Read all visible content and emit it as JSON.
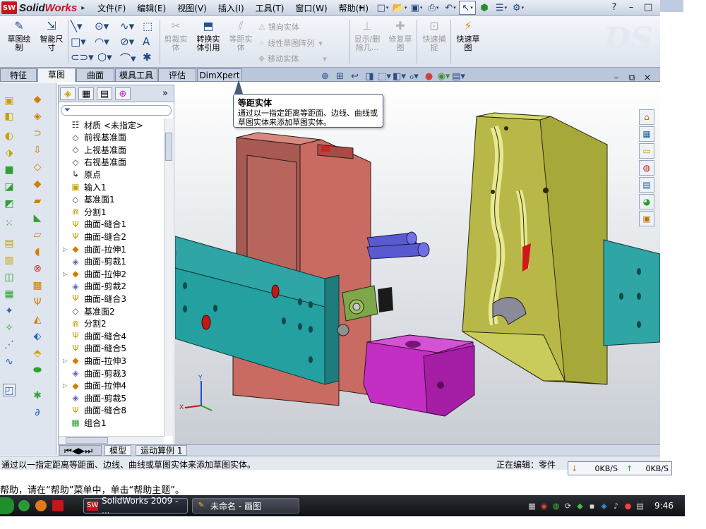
{
  "app": {
    "name": "SolidWorks",
    "name_prefix": "Solid",
    "name_suffix": "Works",
    "logo_mark": "SW"
  },
  "menu": [
    "文件(F)",
    "编辑(E)",
    "视图(V)",
    "插入(I)",
    "工具(T)",
    "窗口(W)",
    "帮助(H)"
  ],
  "quick_access_icons": [
    "new-document-icon",
    "open-icon",
    "save-icon",
    "print-icon",
    "undo-icon",
    "select-arrow-icon",
    "rebuild-icon",
    "file-properties-icon",
    "options-icon"
  ],
  "window_controls": [
    "?",
    "–",
    "□",
    "×"
  ],
  "command_manager": {
    "big_buttons": [
      {
        "label": "草图绘\n制",
        "icon": "sketch-icon",
        "enabled": true
      },
      {
        "label": "智能尺\n寸",
        "icon": "smart-dimension-icon",
        "enabled": true
      },
      {
        "label": "剪裁实\n体",
        "icon": "trim-icon",
        "enabled": false
      },
      {
        "label": "转换实\n体引用",
        "icon": "convert-entities-icon",
        "enabled": true
      },
      {
        "label": "等距实\n体",
        "icon": "offset-entities-icon",
        "enabled": false
      },
      {
        "label": "显示/删\n除几...",
        "icon": "display-relations-icon",
        "enabled": false
      },
      {
        "label": "修复草\n图",
        "icon": "repair-sketch-icon",
        "enabled": false
      },
      {
        "label": "快速捕\n捉",
        "icon": "quick-snaps-icon",
        "enabled": false
      },
      {
        "label": "快速草\n图",
        "icon": "rapid-sketch-icon",
        "enabled": true
      }
    ],
    "list_buttons": [
      "镜向实体",
      "线性草图阵列",
      "移动实体"
    ]
  },
  "tabs": [
    "特征",
    "草图",
    "曲面",
    "模具工具",
    "评估",
    "DimXpert"
  ],
  "active_tab": "草图",
  "feature_tree": {
    "items": [
      {
        "label": "材质 <未指定>",
        "icon": "material-icon",
        "expandable": false
      },
      {
        "label": "前视基准面",
        "icon": "plane-icon",
        "expandable": false
      },
      {
        "label": "上视基准面",
        "icon": "plane-icon",
        "expandable": false
      },
      {
        "label": "右视基准面",
        "icon": "plane-icon",
        "expandable": false
      },
      {
        "label": "原点",
        "icon": "origin-icon",
        "expandable": false
      },
      {
        "label": "输入1",
        "icon": "import-icon",
        "expandable": false
      },
      {
        "label": "基准面1",
        "icon": "plane-icon",
        "expandable": false
      },
      {
        "label": "分割1",
        "icon": "split-icon",
        "expandable": false
      },
      {
        "label": "曲面-缝合1",
        "icon": "knit-surface-icon",
        "expandable": false
      },
      {
        "label": "曲面-缝合2",
        "icon": "knit-surface-icon",
        "expandable": false
      },
      {
        "label": "曲面-拉伸1",
        "icon": "extrude-surface-icon",
        "expandable": true
      },
      {
        "label": "曲面-剪裁1",
        "icon": "trim-surface-icon",
        "expandable": false
      },
      {
        "label": "曲面-拉伸2",
        "icon": "extrude-surface-icon",
        "expandable": true
      },
      {
        "label": "曲面-剪裁2",
        "icon": "trim-surface-icon",
        "expandable": false
      },
      {
        "label": "曲面-缝合3",
        "icon": "knit-surface-icon",
        "expandable": false
      },
      {
        "label": "基准面2",
        "icon": "plane-icon",
        "expandable": false
      },
      {
        "label": "分割2",
        "icon": "split-icon",
        "expandable": false
      },
      {
        "label": "曲面-缝合4",
        "icon": "knit-surface-icon",
        "expandable": false
      },
      {
        "label": "曲面-缝合5",
        "icon": "knit-surface-icon",
        "expandable": false
      },
      {
        "label": "曲面-拉伸3",
        "icon": "extrude-surface-icon",
        "expandable": true
      },
      {
        "label": "曲面-剪裁3",
        "icon": "trim-surface-icon",
        "expandable": false
      },
      {
        "label": "曲面-拉伸4",
        "icon": "extrude-surface-icon",
        "expandable": true
      },
      {
        "label": "曲面-剪裁5",
        "icon": "trim-surface-icon",
        "expandable": false
      },
      {
        "label": "曲面-缝合8",
        "icon": "knit-surface-icon",
        "expandable": false
      },
      {
        "label": "组合1",
        "icon": "combine-icon",
        "expandable": false
      }
    ]
  },
  "bottom_tabs": [
    "模型",
    "运动算例 1"
  ],
  "tooltip": {
    "title": "等距实体",
    "body": "通过以一指定距离等距面、边线、曲线或草图实体来添加草图实体。"
  },
  "status": {
    "message": "通过以一指定距离等距面、边线、曲线或草图实体来添加草图实体。",
    "editing": "正在编辑：零件",
    "net_down": "0KB/S",
    "net_up": "0KB/S"
  },
  "help_line": "帮助，请在“帮助”菜单中，单击“帮助主题”。",
  "taskbar": {
    "tasks": [
      {
        "label": "SolidWorks 2009 - ...",
        "icon": "solidworks-icon",
        "active": true
      },
      {
        "label": "未命名 - 画图",
        "icon": "paint-icon",
        "active": false
      }
    ],
    "clock": "9:46"
  },
  "colors": {
    "mold_pink": "#c96b62",
    "plate_teal": "#2fa5a5",
    "mold_olive": "#c2c24b",
    "block_purple": "#c22fc2",
    "screw_blue": "#5a5ad0"
  }
}
